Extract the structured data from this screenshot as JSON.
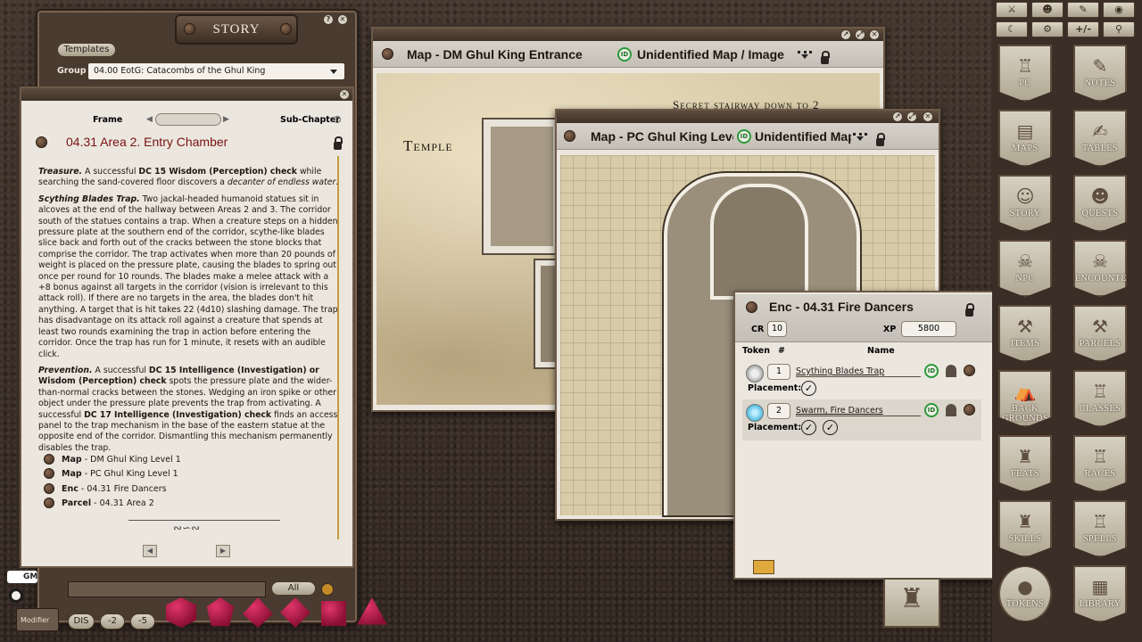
{
  "story_window": {
    "tab_label": "STORY",
    "templates_button": "Templates",
    "group_label": "Group",
    "group_value": "04.00 EotG: Catacombs of the Ghul King",
    "frame_label": "Frame",
    "subchapter_label": "Sub-Chapter",
    "title": "04.31 Area 2. Entry Chamber",
    "treasure_lead": "Treasure.",
    "treasure_text": " A successful ",
    "treasure_check": "DC 15 Wisdom (Perception) check",
    "treasure_text2": " while searching the sand-covered floor discovers a ",
    "treasure_item": "decanter of endless water",
    "treasure_end": ".",
    "trap_lead": "Scything Blades Trap.",
    "trap_text": " Two jackal-headed humanoid statues sit in alcoves at the end of the hallway between Areas 2 and 3. The corridor south of the statues contains a trap. When a creature steps on a hidden pressure plate at the southern end of the corridor, scythe-like blades slice back and forth out of the cracks between the stone blocks that comprise the corridor. The trap activates when more than 20 pounds of weight is placed on the pressure plate, causing the blades to spring out once per round for 10 rounds. The blades make a melee attack with a +8 bonus against all targets in the corridor (vision is irrelevant to this attack roll). If there are no targets in the area, the blades don't hit anything. A target that is hit takes 22 (4d10) slashing damage. The trap has disadvantage on its attack roll against a creature that spends at least two rounds examining the trap in action before entering the corridor. Once the trap has run for 1 minute, it resets with an audible click.",
    "prevention_lead": "Prevention.",
    "prevention_text1": " A successful ",
    "prevention_check1": "DC 15 Intelligence (Investigation) or Wisdom (Perception) check",
    "prevention_text2": " spots the pressure plate and the wider-than-normal cracks between the stones. Wedging an iron spike or other object under the pressure plate prevents the trap from activating. A successful ",
    "prevention_check2": "DC 17 Intelligence (Investigation) check",
    "prevention_text3": " finds an access panel to the trap mechanism in the base of the eastern statue at the opposite end of the corridor. Dismantling this mechanism permanently disables the trap.",
    "links": [
      {
        "type": "Map",
        "name": " - DM Ghul King Level 1"
      },
      {
        "type": "Map",
        "name": " - PC Ghul King Level 1"
      },
      {
        "type": "Enc",
        "name": " - 04.31 Fire Dancers"
      },
      {
        "type": "Parcel",
        "name": " - 04.31 Area 2"
      }
    ],
    "filter_all": "All"
  },
  "map_dm": {
    "title": "Map - DM Ghul King Entrance",
    "id_label": "Unidentified Map / Image",
    "label_secret": "Secret stairway down to 2",
    "label_temple": "Temple"
  },
  "map_pc": {
    "title": "Map - PC Ghul King Level",
    "id_label": "Unidentified Map / Image"
  },
  "encounter": {
    "title": "Enc - 04.31 Fire Dancers",
    "cr_label": "CR",
    "cr_value": "10",
    "xp_label": "XP",
    "xp_value": "5800",
    "col_token": "Token",
    "col_num": "#",
    "col_name": "Name",
    "placement_label": "Placement:",
    "rows": [
      {
        "count": "1",
        "name": "Scything Blades Trap"
      },
      {
        "count": "2",
        "name": "Swarm, Fire Dancers"
      }
    ]
  },
  "toolbar": {
    "tools": [
      "⚔",
      "👥",
      "✎",
      "◉",
      "☾",
      "⚙",
      "+/-",
      "🚶"
    ]
  },
  "sidebar_tabs": [
    {
      "label": "PC",
      "icon": "helmet-icon",
      "glyph": "♖"
    },
    {
      "label": "NOTES",
      "icon": "quill-icon",
      "glyph": "✎"
    },
    {
      "label": "MAPS",
      "icon": "map-icon",
      "glyph": "▤"
    },
    {
      "label": "TABLES",
      "icon": "table-icon",
      "glyph": "✍"
    },
    {
      "label": "STORY",
      "icon": "masks-icon",
      "glyph": "☺"
    },
    {
      "label": "QUESTS",
      "icon": "masks-icon",
      "glyph": "☻"
    },
    {
      "label": "NPC",
      "icon": "monster-icon",
      "glyph": "☠"
    },
    {
      "label": "ENCOUNTERS",
      "icon": "monster-icon",
      "glyph": "☠"
    },
    {
      "label": "ITEMS",
      "icon": "sack-icon",
      "glyph": "⚒"
    },
    {
      "label": "PARCELS",
      "icon": "sack-icon",
      "glyph": "⚒"
    },
    {
      "label": "BACK GROUNDS",
      "icon": "tent-icon",
      "glyph": "⛺"
    },
    {
      "label": "CLASSES",
      "icon": "helmet-icon",
      "glyph": "♖"
    },
    {
      "label": "FEATS",
      "icon": "hat-icon",
      "glyph": "♜"
    },
    {
      "label": "RACES",
      "icon": "helmet-icon",
      "glyph": "♖"
    },
    {
      "label": "SKILLS",
      "icon": "hat-icon",
      "glyph": "♜"
    },
    {
      "label": "SPELLS",
      "icon": "helmet-icon",
      "glyph": "♖"
    },
    {
      "label": "TOKENS",
      "icon": "token-icon",
      "glyph": "●"
    },
    {
      "label": "LIBRARY",
      "icon": "library-icon",
      "glyph": "▦"
    }
  ],
  "bottom_bar": {
    "chat_mode": "GM",
    "modifier_label": "Modifier",
    "dis_label": "DIS",
    "mod_minus2": "-2",
    "mod_minus5": "-5",
    "dice": [
      "d4",
      "d6",
      "d8",
      "d10",
      "d12",
      "d20"
    ]
  },
  "colors": {
    "accent_red": "#7a1212",
    "id_green": "#2b9a3a",
    "dice": "#c21a4f"
  }
}
